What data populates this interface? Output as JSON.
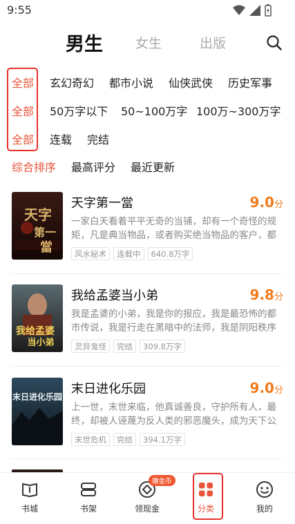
{
  "status_bar": {
    "time": "9:55"
  },
  "top_tabs": [
    {
      "label": "男生",
      "active": true
    },
    {
      "label": "女生",
      "active": false
    },
    {
      "label": "出版",
      "active": false
    }
  ],
  "filters": [
    {
      "all_label": "全部",
      "options": [
        "玄幻奇幻",
        "都市小说",
        "仙侠武侠",
        "历史军事"
      ]
    },
    {
      "all_label": "全部",
      "options": [
        "50万字以下",
        "50~100万字",
        "100万~300万字"
      ]
    },
    {
      "all_label": "全部",
      "options": [
        "连载",
        "完结"
      ]
    }
  ],
  "sort": [
    "综合排序",
    "最高评分",
    "最近更新"
  ],
  "books": [
    {
      "title": "天字第一當",
      "score": "9.0",
      "score_unit": "分",
      "desc": "一家白天看着平平无奇的当铺，却有一个奇怪的规矩，凡是典当物品，或者购买绝当物品的客户，都",
      "tags": [
        "风水秘术",
        "连载中",
        "640.8万字"
      ],
      "cover_text": "天字第一當"
    },
    {
      "title": "我给孟婆当小弟",
      "score": "9.8",
      "score_unit": "分",
      "desc": "我是孟婆的小弟，我是你的报应，我是最恐怖的都市传说，我是行走在黑暗中的法师，我是阴阳秩序",
      "tags": [
        "灵异鬼怪",
        "完结",
        "309.8万字"
      ],
      "cover_text": "我给孟婆当小弟"
    },
    {
      "title": "末日进化乐园",
      "score": "9.0",
      "score_unit": "分",
      "desc": "上一世，末世来临，他真诚善良，守护所有人，最终，却被人诬蔑为反人类的邪恶魔头，成为天下公",
      "tags": [
        "末世危机",
        "完结",
        "394.1万字"
      ],
      "cover_text": "末日进化乐园"
    }
  ],
  "bottom_nav": [
    {
      "label": "书城",
      "icon": "book-open-icon"
    },
    {
      "label": "书架",
      "icon": "bookshelf-icon"
    },
    {
      "label": "领现金",
      "icon": "cash-diamond-icon",
      "badge": "赚金币"
    },
    {
      "label": "分类",
      "icon": "category-grid-icon",
      "active": true
    },
    {
      "label": "我的",
      "icon": "smiley-face-icon"
    }
  ],
  "colors": {
    "accent": "#e8553a",
    "score": "#f07c1e",
    "highlight_box": "#e8302a"
  }
}
